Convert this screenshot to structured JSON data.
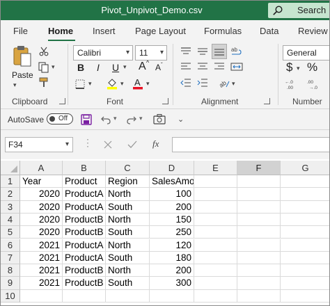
{
  "window": {
    "title": "Pivot_Unpivot_Demo.csv",
    "search_label": "Search",
    "accent": "#217346"
  },
  "tabs": [
    "File",
    "Home",
    "Insert",
    "Page Layout",
    "Formulas",
    "Data",
    "Review"
  ],
  "active_tab": "Home",
  "ribbon": {
    "clipboard": {
      "label": "Clipboard",
      "paste_label": "Paste"
    },
    "font": {
      "label": "Font",
      "font_name": "Calibri",
      "font_size": "11",
      "bold": "B",
      "italic": "I",
      "underline": "U",
      "grow": "A",
      "shrink": "A"
    },
    "alignment": {
      "label": "Alignment"
    },
    "number": {
      "label": "Number",
      "format": "General",
      "currency": "$",
      "percent": "%"
    }
  },
  "qat": {
    "autosave_label": "AutoSave",
    "autosave_state": "Off"
  },
  "formula_bar": {
    "name_box": "F34",
    "fx_label": "fx",
    "formula": ""
  },
  "sheet": {
    "columns": [
      "A",
      "B",
      "C",
      "D",
      "E",
      "F",
      "G"
    ],
    "selected_column": "F",
    "row_numbers": [
      "1",
      "2",
      "3",
      "4",
      "5",
      "6",
      "7",
      "8",
      "9",
      "10"
    ],
    "headers": [
      "Year",
      "Product",
      "Region",
      "SalesAmount"
    ],
    "rows": [
      [
        "2020",
        "ProductA",
        "North",
        "100"
      ],
      [
        "2020",
        "ProductA",
        "South",
        "200"
      ],
      [
        "2020",
        "ProductB",
        "North",
        "150"
      ],
      [
        "2020",
        "ProductB",
        "South",
        "250"
      ],
      [
        "2021",
        "ProductA",
        "North",
        "120"
      ],
      [
        "2021",
        "ProductA",
        "South",
        "180"
      ],
      [
        "2021",
        "ProductB",
        "North",
        "200"
      ],
      [
        "2021",
        "ProductB",
        "South",
        "300"
      ]
    ]
  }
}
